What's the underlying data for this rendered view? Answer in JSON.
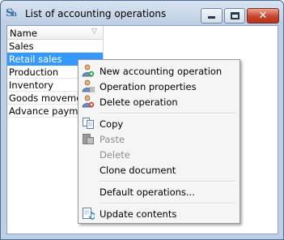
{
  "window": {
    "title": "List of accounting operations",
    "app_icon_text": "S",
    "app_icon_sub": "h",
    "close_glyph": "✕"
  },
  "grid": {
    "header": "Name",
    "filter_glyph": "▽",
    "rows": [
      "Sales",
      "Retail sales",
      "Production",
      "Inventory",
      "Goods movement",
      "Advance payment"
    ],
    "selected_row": "Retail sales"
  },
  "context_menu": {
    "items": [
      {
        "label": "New accounting operation",
        "icon": "user-add-icon",
        "enabled": true
      },
      {
        "label": "Operation properties",
        "icon": "user-properties-icon",
        "enabled": true
      },
      {
        "label": "Delete operation",
        "icon": "user-delete-icon",
        "enabled": true
      },
      {
        "label": "Copy",
        "icon": "copy-icon",
        "enabled": true
      },
      {
        "label": "Paste",
        "icon": "paste-icon",
        "enabled": false
      },
      {
        "label": "Delete",
        "icon": "",
        "enabled": false
      },
      {
        "label": "Clone document",
        "icon": "",
        "enabled": true
      },
      {
        "label": "Default operations...",
        "icon": "",
        "enabled": true
      },
      {
        "label": "Update contents",
        "icon": "refresh-icon",
        "enabled": true
      }
    ]
  },
  "colors": {
    "selection": "#3399ff",
    "close_button": "#c7442a",
    "frame": "#bfcfe3"
  }
}
